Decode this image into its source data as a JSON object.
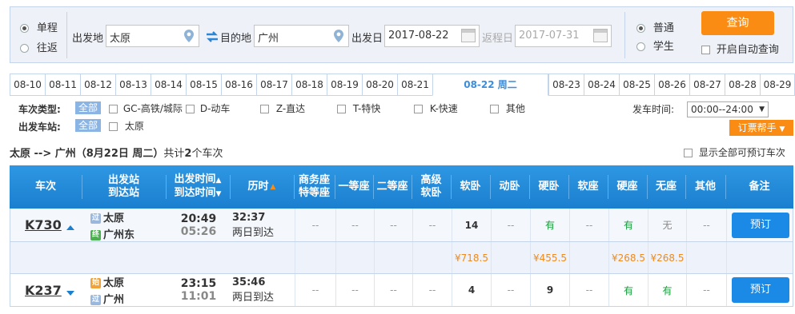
{
  "search": {
    "trip_types": [
      "单程",
      "往返"
    ],
    "from_label": "出发地",
    "from_value": "太原",
    "to_label": "目的地",
    "to_value": "广州",
    "depart_label": "出发日",
    "depart_value": "2017-08-22",
    "return_label": "返程日",
    "return_value": "2017-07-31",
    "passenger_types": [
      "普通",
      "学生"
    ],
    "query_button": "查询",
    "auto_query_label": "开启自动查询"
  },
  "date_tabs": [
    "08-10",
    "08-11",
    "08-12",
    "08-13",
    "08-14",
    "08-15",
    "08-16",
    "08-17",
    "08-18",
    "08-19",
    "08-20",
    "08-21",
    "08-22 周二",
    "08-23",
    "08-24",
    "08-25",
    "08-26",
    "08-27",
    "08-28",
    "08-29"
  ],
  "filters": {
    "type_label": "车次类型:",
    "station_label": "出发车站:",
    "all_label": "全部",
    "train_types": [
      "GC-高铁/城际",
      "D-动车",
      "Z-直达",
      "T-特快",
      "K-快速",
      "其他"
    ],
    "station_option": "太原",
    "time_label": "发车时间:",
    "time_value": "00:00--24:00",
    "helper_label": "订票帮手"
  },
  "summary": {
    "route": "太原 --> 广州（8月22日  周二）",
    "count_prefix": "共计",
    "count": "2",
    "count_suffix": "个车次",
    "show_all_label": "显示全部可预订车次"
  },
  "table": {
    "headers": {
      "train": "车次",
      "stations_1": "出发站",
      "stations_2": "到达站",
      "time_1": "出发时间",
      "time_2": "到达时间",
      "duration": "历时",
      "business_1": "商务座",
      "business_2": "特等座",
      "first": "一等座",
      "second": "二等座",
      "highsoft_1": "高级",
      "highsoft_2": "软卧",
      "soft_sleeper": "软卧",
      "dongwo": "动卧",
      "hard_sleeper": "硬卧",
      "soft_seat": "软座",
      "hard_seat": "硬座",
      "no_seat": "无座",
      "other": "其他",
      "remark": "备注"
    },
    "trains": [
      {
        "no": "K730",
        "from_badge": "过",
        "from": "太原",
        "to_badge": "终",
        "to": "广州东",
        "depart": "20:49",
        "arrive": "05:26",
        "duration": "32:37",
        "arrive_day": "两日到达",
        "business": "--",
        "first": "--",
        "second": "--",
        "highsoft": "--",
        "soft_sleeper": "14",
        "dongwo": "--",
        "hard_sleeper": "有",
        "soft_seat": "--",
        "hard_seat": "有",
        "no_seat": "无",
        "other": "--",
        "book": "预订",
        "prices": {
          "soft_sleeper": "¥718.5",
          "hard_sleeper": "¥455.5",
          "hard_seat": "¥268.5",
          "no_seat": "¥268.5"
        }
      },
      {
        "no": "K237",
        "from_badge": "始",
        "from": "太原",
        "to_badge": "过",
        "to": "广州",
        "depart": "23:15",
        "arrive": "11:01",
        "duration": "35:46",
        "arrive_day": "两日到达",
        "business": "--",
        "first": "--",
        "second": "--",
        "highsoft": "--",
        "soft_sleeper": "4",
        "dongwo": "--",
        "hard_sleeper": "9",
        "soft_seat": "--",
        "hard_seat": "有",
        "no_seat": "有",
        "other": "--",
        "book": "预订"
      }
    ]
  },
  "colors": {
    "accent": "#1a8ae6",
    "orange": "#fb8c13",
    "green": "#1a9c3c",
    "price": "#f08a1c"
  }
}
